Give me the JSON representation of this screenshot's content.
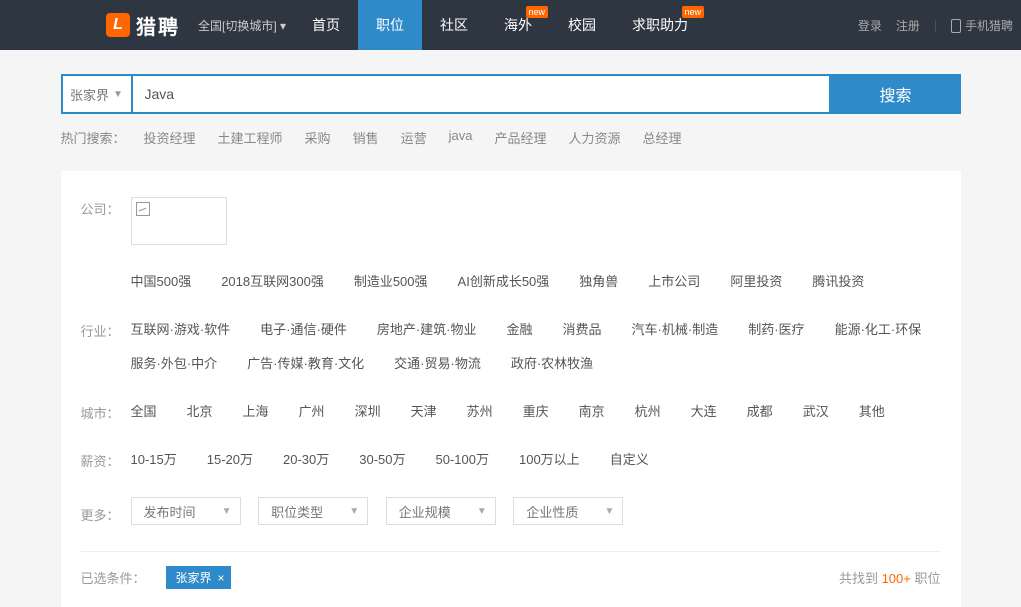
{
  "header": {
    "logo_text": "猎聘",
    "city_selector": "全国[切换城市]",
    "nav": [
      {
        "label": "首页",
        "badge": null
      },
      {
        "label": "职位",
        "badge": null,
        "active": true
      },
      {
        "label": "社区",
        "badge": null
      },
      {
        "label": "海外",
        "badge": "new"
      },
      {
        "label": "校园",
        "badge": null
      },
      {
        "label": "求职助力",
        "badge": "new"
      }
    ],
    "login": "登录",
    "register": "注册",
    "mobile": "手机猎聘"
  },
  "search": {
    "city": "张家界",
    "value": "Java",
    "button": "搜索"
  },
  "hot": {
    "label": "热门搜索：",
    "items": [
      "投资经理",
      "土建工程师",
      "采购",
      "销售",
      "运营",
      "java",
      "产品经理",
      "人力资源",
      "总经理"
    ]
  },
  "filters": {
    "company": {
      "label": "公司："
    },
    "company_tags": [
      "中国500强",
      "2018互联网300强",
      "制造业500强",
      "AI创新成长50强",
      "独角兽",
      "上市公司",
      "阿里投资",
      "腾讯投资"
    ],
    "industry": {
      "label": "行业：",
      "items": [
        "互联网·游戏·软件",
        "电子·通信·硬件",
        "房地产·建筑·物业",
        "金融",
        "消费品",
        "汽车·机械·制造",
        "制药·医疗",
        "能源·化工·环保",
        "服务·外包·中介",
        "广告·传媒·教育·文化",
        "交通·贸易·物流",
        "政府·农林牧渔"
      ]
    },
    "city": {
      "label": "城市：",
      "items": [
        "全国",
        "北京",
        "上海",
        "广州",
        "深圳",
        "天津",
        "苏州",
        "重庆",
        "南京",
        "杭州",
        "大连",
        "成都",
        "武汉",
        "其他"
      ]
    },
    "salary": {
      "label": "薪资：",
      "items": [
        "10-15万",
        "15-20万",
        "20-30万",
        "30-50万",
        "50-100万",
        "100万以上",
        "自定义"
      ]
    },
    "more": {
      "label": "更多：",
      "dropdowns": [
        "发布时间",
        "职位类型",
        "企业规模",
        "企业性质"
      ]
    }
  },
  "selected": {
    "label": "已选条件：",
    "chip": "张家界",
    "result_prefix": "共找到 ",
    "result_count": "100+",
    "result_suffix": " 职位"
  }
}
